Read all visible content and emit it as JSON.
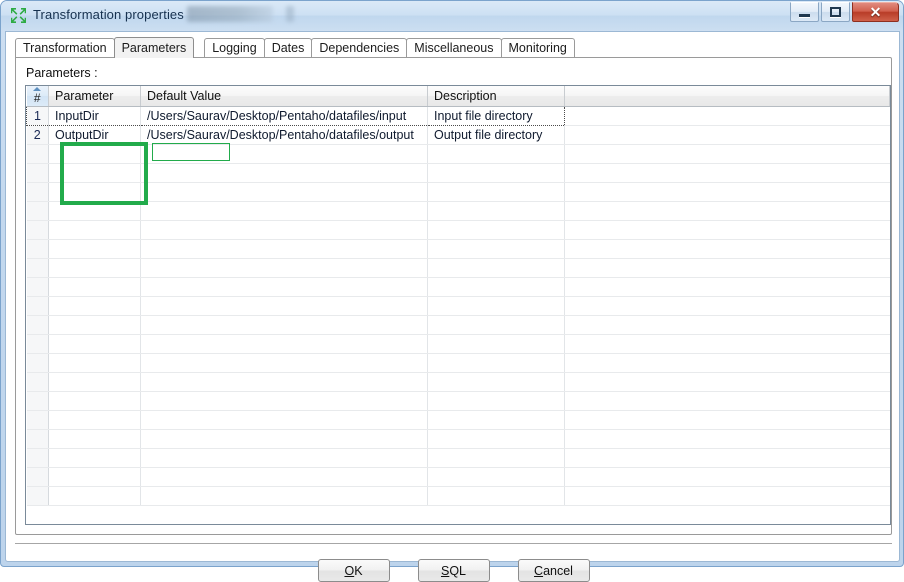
{
  "window": {
    "title": "Transformation properties",
    "icon": "pentaho-converge-arrows-icon",
    "controls": {
      "minimize_label": "–",
      "maximize_label": "□",
      "close_label": "✕"
    }
  },
  "tabs": [
    {
      "label": "Transformation",
      "selected": false
    },
    {
      "label": "Parameters",
      "selected": true
    },
    {
      "label": "Logging",
      "selected": false
    },
    {
      "label": "Dates",
      "selected": false
    },
    {
      "label": "Dependencies",
      "selected": false
    },
    {
      "label": "Miscellaneous",
      "selected": false
    },
    {
      "label": "Monitoring",
      "selected": false
    }
  ],
  "panel": {
    "section_label": "Parameters :",
    "table": {
      "columns": [
        "#",
        "Parameter",
        "Default Value",
        "Description",
        ""
      ],
      "rows": [
        {
          "num": "1",
          "parameter": "InputDir",
          "default_value": "/Users/Saurav/Desktop/Pentaho/datafiles/input",
          "description": "Input file directory",
          "focused": true
        },
        {
          "num": "2",
          "parameter": "OutputDir",
          "default_value": "/Users/Saurav/Desktop/Pentaho/datafiles/output",
          "description": "Output file directory",
          "focused": false
        }
      ],
      "empty_row_count": 19
    }
  },
  "highlights": {
    "color": "#22ab4b",
    "parameter_column": "Parameter column values highlighted",
    "default_value_header": "Default Value header highlighted"
  },
  "footer": {
    "buttons": [
      {
        "mnemonic": "O",
        "rest": "K"
      },
      {
        "mnemonic": "S",
        "rest": "QL"
      },
      {
        "mnemonic": "C",
        "rest": "ancel"
      }
    ]
  }
}
